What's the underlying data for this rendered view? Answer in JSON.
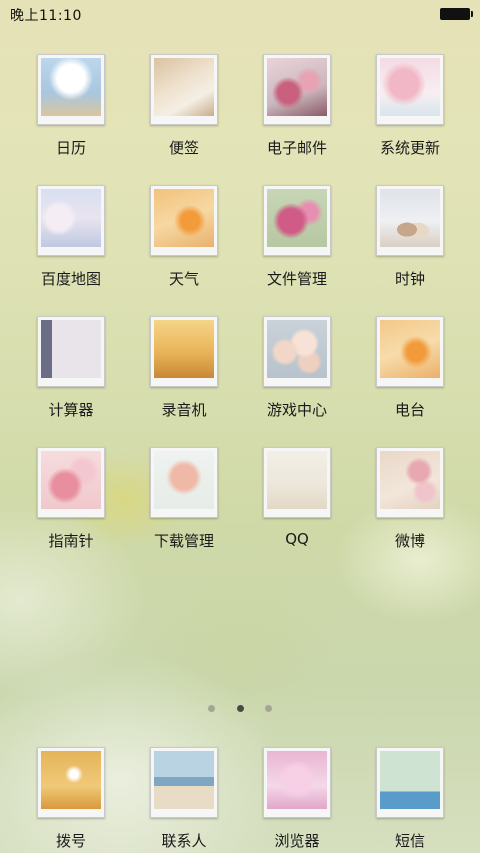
{
  "status_bar": {
    "time": "晚上11:10",
    "battery_icon": "battery-icon"
  },
  "apps": [
    {
      "label": "日历",
      "icon": "calendar-icon"
    },
    {
      "label": "便签",
      "icon": "note-icon"
    },
    {
      "label": "电子邮件",
      "icon": "email-icon"
    },
    {
      "label": "系统更新",
      "icon": "system-update-icon"
    },
    {
      "label": "百度地图",
      "icon": "map-icon"
    },
    {
      "label": "天气",
      "icon": "weather-icon"
    },
    {
      "label": "文件管理",
      "icon": "file-manager-icon"
    },
    {
      "label": "时钟",
      "icon": "clock-icon"
    },
    {
      "label": "计算器",
      "icon": "calculator-icon"
    },
    {
      "label": "录音机",
      "icon": "recorder-icon"
    },
    {
      "label": "游戏中心",
      "icon": "game-center-icon"
    },
    {
      "label": "电台",
      "icon": "radio-icon"
    },
    {
      "label": "指南针",
      "icon": "compass-icon"
    },
    {
      "label": "下载管理",
      "icon": "download-manager-icon"
    },
    {
      "label": "QQ",
      "icon": "qq-icon"
    },
    {
      "label": "微博",
      "icon": "weibo-icon"
    }
  ],
  "page_indicator": {
    "count": 3,
    "active_index": 1
  },
  "dock": [
    {
      "label": "拨号",
      "icon": "phone-icon"
    },
    {
      "label": "联系人",
      "icon": "contacts-icon"
    },
    {
      "label": "浏览器",
      "icon": "browser-icon"
    },
    {
      "label": "短信",
      "icon": "sms-icon"
    }
  ]
}
